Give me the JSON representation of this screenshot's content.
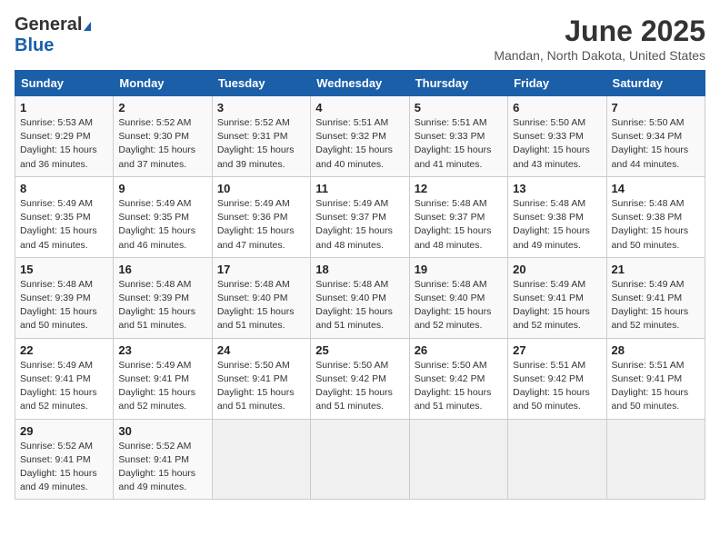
{
  "header": {
    "logo_general": "General",
    "logo_blue": "Blue",
    "month_title": "June 2025",
    "location": "Mandan, North Dakota, United States"
  },
  "days_of_week": [
    "Sunday",
    "Monday",
    "Tuesday",
    "Wednesday",
    "Thursday",
    "Friday",
    "Saturday"
  ],
  "weeks": [
    [
      {
        "num": "1",
        "sunrise": "5:53 AM",
        "sunset": "9:29 PM",
        "daylight": "15 hours and 36 minutes."
      },
      {
        "num": "2",
        "sunrise": "5:52 AM",
        "sunset": "9:30 PM",
        "daylight": "15 hours and 37 minutes."
      },
      {
        "num": "3",
        "sunrise": "5:52 AM",
        "sunset": "9:31 PM",
        "daylight": "15 hours and 39 minutes."
      },
      {
        "num": "4",
        "sunrise": "5:51 AM",
        "sunset": "9:32 PM",
        "daylight": "15 hours and 40 minutes."
      },
      {
        "num": "5",
        "sunrise": "5:51 AM",
        "sunset": "9:33 PM",
        "daylight": "15 hours and 41 minutes."
      },
      {
        "num": "6",
        "sunrise": "5:50 AM",
        "sunset": "9:33 PM",
        "daylight": "15 hours and 43 minutes."
      },
      {
        "num": "7",
        "sunrise": "5:50 AM",
        "sunset": "9:34 PM",
        "daylight": "15 hours and 44 minutes."
      }
    ],
    [
      {
        "num": "8",
        "sunrise": "5:49 AM",
        "sunset": "9:35 PM",
        "daylight": "15 hours and 45 minutes."
      },
      {
        "num": "9",
        "sunrise": "5:49 AM",
        "sunset": "9:35 PM",
        "daylight": "15 hours and 46 minutes."
      },
      {
        "num": "10",
        "sunrise": "5:49 AM",
        "sunset": "9:36 PM",
        "daylight": "15 hours and 47 minutes."
      },
      {
        "num": "11",
        "sunrise": "5:49 AM",
        "sunset": "9:37 PM",
        "daylight": "15 hours and 48 minutes."
      },
      {
        "num": "12",
        "sunrise": "5:48 AM",
        "sunset": "9:37 PM",
        "daylight": "15 hours and 48 minutes."
      },
      {
        "num": "13",
        "sunrise": "5:48 AM",
        "sunset": "9:38 PM",
        "daylight": "15 hours and 49 minutes."
      },
      {
        "num": "14",
        "sunrise": "5:48 AM",
        "sunset": "9:38 PM",
        "daylight": "15 hours and 50 minutes."
      }
    ],
    [
      {
        "num": "15",
        "sunrise": "5:48 AM",
        "sunset": "9:39 PM",
        "daylight": "15 hours and 50 minutes."
      },
      {
        "num": "16",
        "sunrise": "5:48 AM",
        "sunset": "9:39 PM",
        "daylight": "15 hours and 51 minutes."
      },
      {
        "num": "17",
        "sunrise": "5:48 AM",
        "sunset": "9:40 PM",
        "daylight": "15 hours and 51 minutes."
      },
      {
        "num": "18",
        "sunrise": "5:48 AM",
        "sunset": "9:40 PM",
        "daylight": "15 hours and 51 minutes."
      },
      {
        "num": "19",
        "sunrise": "5:48 AM",
        "sunset": "9:40 PM",
        "daylight": "15 hours and 52 minutes."
      },
      {
        "num": "20",
        "sunrise": "5:49 AM",
        "sunset": "9:41 PM",
        "daylight": "15 hours and 52 minutes."
      },
      {
        "num": "21",
        "sunrise": "5:49 AM",
        "sunset": "9:41 PM",
        "daylight": "15 hours and 52 minutes."
      }
    ],
    [
      {
        "num": "22",
        "sunrise": "5:49 AM",
        "sunset": "9:41 PM",
        "daylight": "15 hours and 52 minutes."
      },
      {
        "num": "23",
        "sunrise": "5:49 AM",
        "sunset": "9:41 PM",
        "daylight": "15 hours and 52 minutes."
      },
      {
        "num": "24",
        "sunrise": "5:50 AM",
        "sunset": "9:41 PM",
        "daylight": "15 hours and 51 minutes."
      },
      {
        "num": "25",
        "sunrise": "5:50 AM",
        "sunset": "9:42 PM",
        "daylight": "15 hours and 51 minutes."
      },
      {
        "num": "26",
        "sunrise": "5:50 AM",
        "sunset": "9:42 PM",
        "daylight": "15 hours and 51 minutes."
      },
      {
        "num": "27",
        "sunrise": "5:51 AM",
        "sunset": "9:42 PM",
        "daylight": "15 hours and 50 minutes."
      },
      {
        "num": "28",
        "sunrise": "5:51 AM",
        "sunset": "9:41 PM",
        "daylight": "15 hours and 50 minutes."
      }
    ],
    [
      {
        "num": "29",
        "sunrise": "5:52 AM",
        "sunset": "9:41 PM",
        "daylight": "15 hours and 49 minutes."
      },
      {
        "num": "30",
        "sunrise": "5:52 AM",
        "sunset": "9:41 PM",
        "daylight": "15 hours and 49 minutes."
      },
      null,
      null,
      null,
      null,
      null
    ]
  ]
}
